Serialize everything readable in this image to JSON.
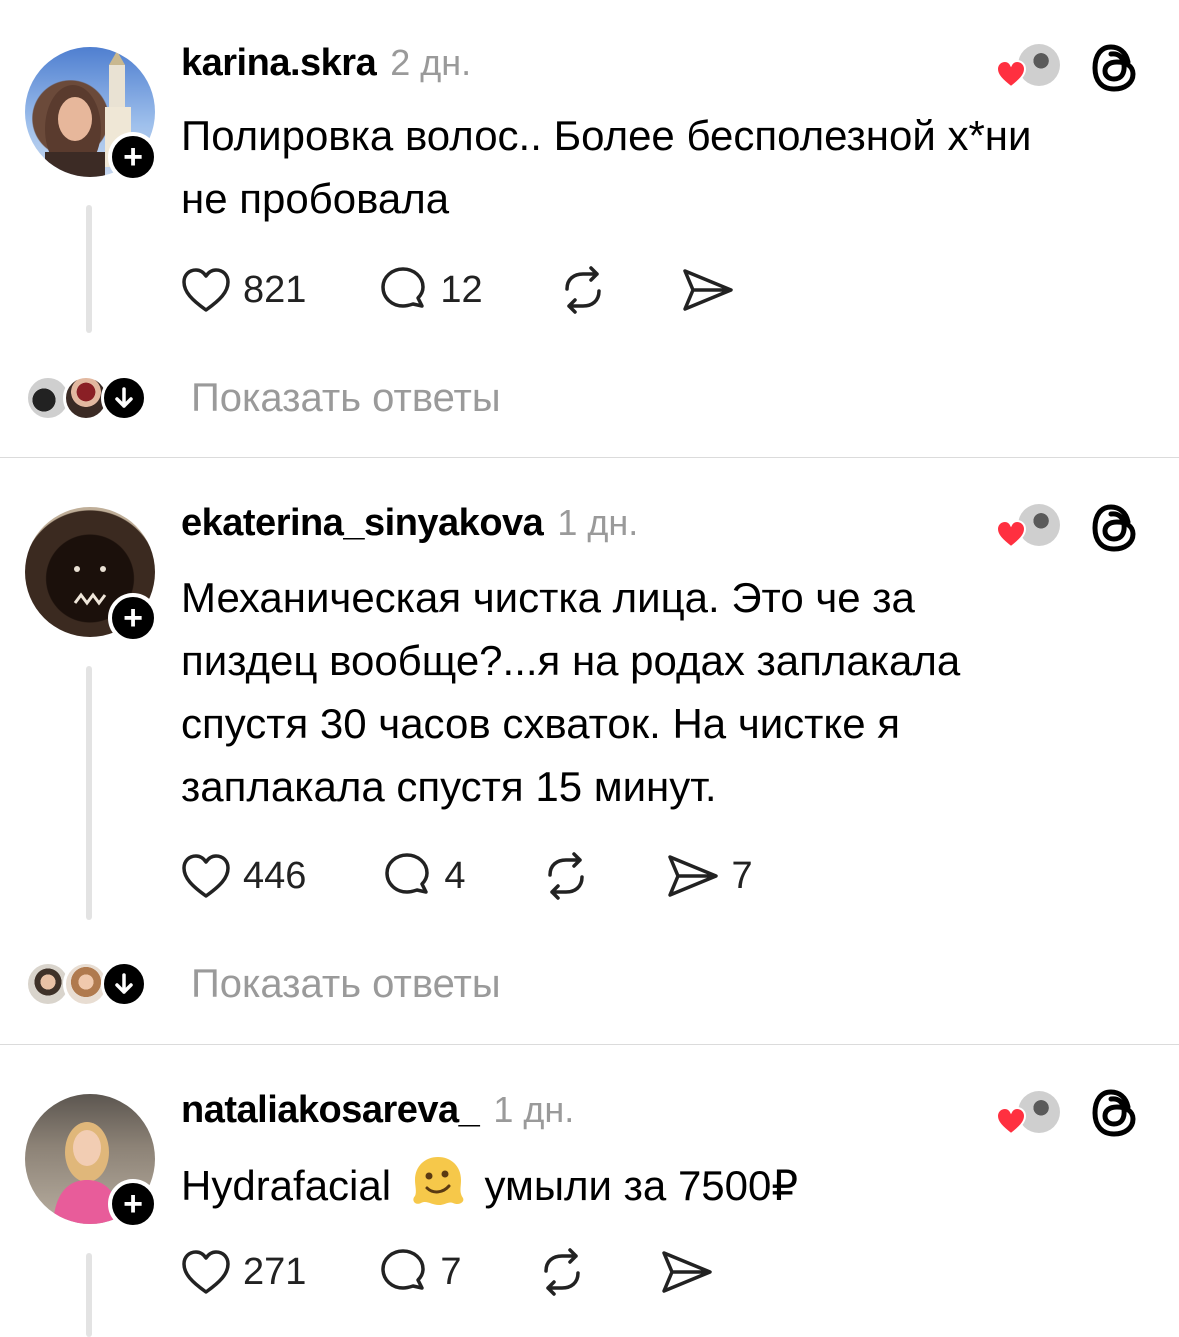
{
  "posts": [
    {
      "username": "karina.skra",
      "time": "2 дн.",
      "text_lines": [
        "Полировка волос.. Более бесполезной х*ни",
        "не пробовала"
      ],
      "likes": "821",
      "comments": "12",
      "shares": "",
      "show_replies": "Показать ответы",
      "avatar_colors": [
        "#7fa7d9",
        "#c9a78c"
      ]
    },
    {
      "username": "ekaterina_sinyakova",
      "time": "1 дн.",
      "text_lines": [
        "Механическая чистка лица. Это че за",
        "пиздец вообще?...я на родах заплакала",
        "спустя 30 часов схваток. На чистке я",
        "заплакала спустя 15 минут."
      ],
      "likes": "446",
      "comments": "4",
      "shares": "7",
      "show_replies": "Показать ответы",
      "avatar_colors": [
        "#2a1a12",
        "#4a3326"
      ]
    },
    {
      "username": "nataliakosareva_",
      "time": "1 дн.",
      "text_before_emoji": "Hydrafacial",
      "text_after_emoji": "умыли за 7500₽",
      "emoji": "melting-face-emoji",
      "likes": "271",
      "comments": "7",
      "shares": "",
      "avatar_colors": [
        "#e85c9a",
        "#d8c2a8"
      ]
    }
  ],
  "colors": {
    "heart_red": "#ff3040",
    "muted_text": "#9a9a9a",
    "divider": "#dbdbdb"
  },
  "icons": [
    "heart-icon",
    "comment-icon",
    "repost-icon",
    "share-icon",
    "threads-logo-icon",
    "follow-plus-icon",
    "arrow-down-icon"
  ]
}
